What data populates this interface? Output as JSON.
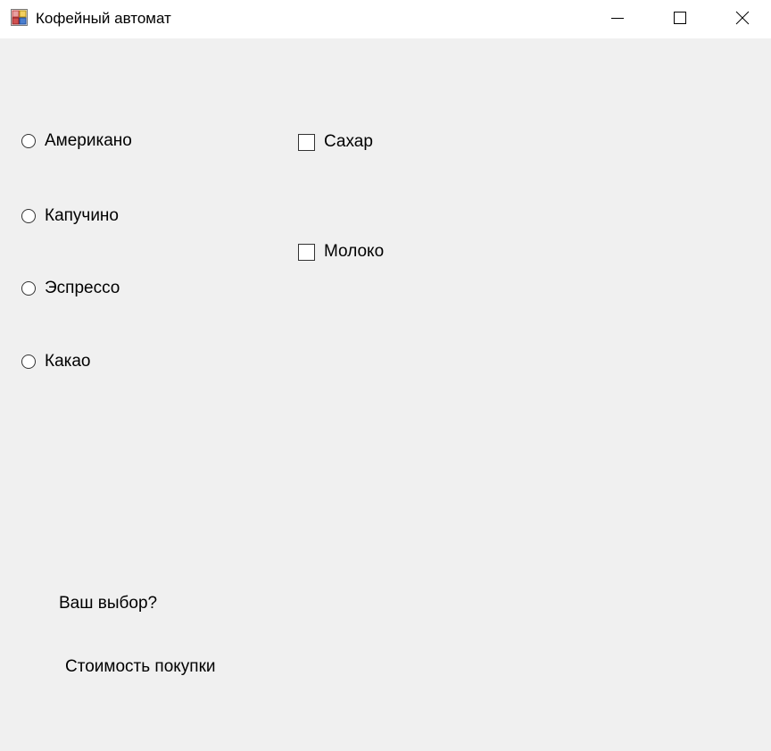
{
  "window": {
    "title": "Кофейный автомат",
    "icon": "windows-form-icon",
    "controls": {
      "minimize_icon": "minimize-icon",
      "maximize_icon": "maximize-icon",
      "close_icon": "close-icon"
    }
  },
  "drinks": [
    {
      "label": "Американо",
      "selected": false
    },
    {
      "label": "Капучино",
      "selected": false
    },
    {
      "label": "Эспрессо",
      "selected": false
    },
    {
      "label": "Какао",
      "selected": false
    }
  ],
  "additions": [
    {
      "label": "Сахар",
      "checked": false
    },
    {
      "label": "Молоко",
      "checked": false
    }
  ],
  "labels": {
    "choice": "Ваш выбор?",
    "cost": "Стоимость покупки"
  },
  "colors": {
    "background": "#f0f0f0",
    "titlebar": "#ffffff"
  }
}
